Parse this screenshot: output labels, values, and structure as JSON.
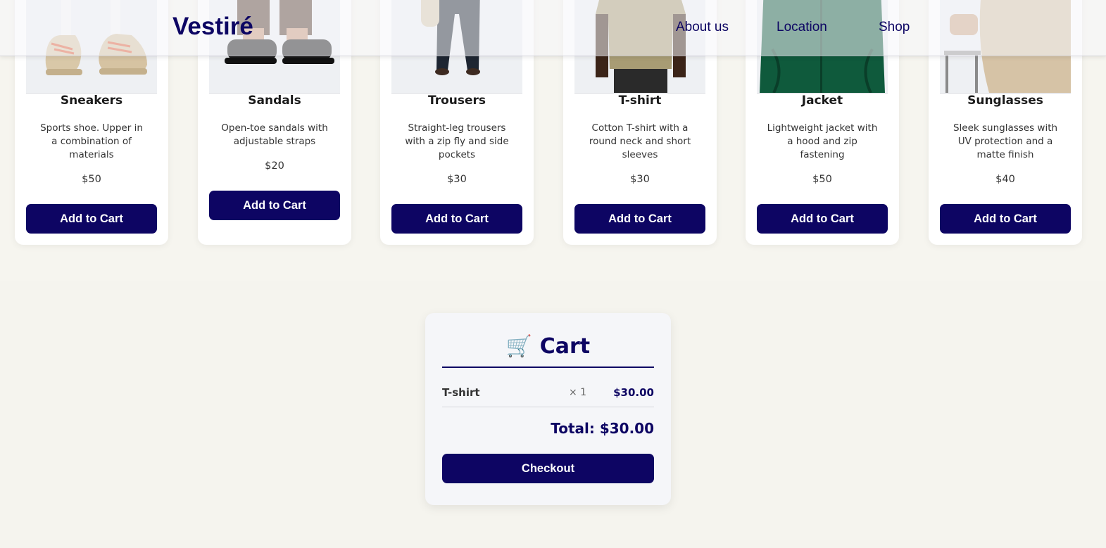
{
  "header": {
    "logo": "Vestiré",
    "nav": [
      "About us",
      "Location",
      "Shop"
    ]
  },
  "products": [
    {
      "name": "Sneakers",
      "description": "Sports shoe. Upper in a combination of materials",
      "price": "$50",
      "button": "Add to Cart",
      "image": "sneakers-photo"
    },
    {
      "name": "Sandals",
      "description": "Open-toe sandals with adjustable straps",
      "price": "$20",
      "button": "Add to Cart",
      "image": "sandals-photo"
    },
    {
      "name": "Trousers",
      "description": "Straight-leg trousers with a zip fly and side pockets",
      "price": "$30",
      "button": "Add to Cart",
      "image": "trousers-photo"
    },
    {
      "name": "T-shirt",
      "description": "Cotton T-shirt with a round neck and short sleeves",
      "price": "$30",
      "button": "Add to Cart",
      "image": "tshirt-photo"
    },
    {
      "name": "Jacket",
      "description": "Lightweight jacket with a hood and zip fastening",
      "price": "$50",
      "button": "Add to Cart",
      "image": "jacket-photo"
    },
    {
      "name": "Sunglasses",
      "description": "Sleek sunglasses with UV protection and a matte finish",
      "price": "$40",
      "button": "Add to Cart",
      "image": "sunglasses-photo"
    }
  ],
  "cart": {
    "icon": "🛒",
    "title": "Cart",
    "items": [
      {
        "name": "T-shirt",
        "qty": "× 1",
        "price": "$30.00"
      }
    ],
    "total": "Total: $30.00",
    "checkout": "Checkout"
  },
  "colors": {
    "accent": "#0d0563",
    "background": "#f5f4ee",
    "card": "#ffffff"
  }
}
